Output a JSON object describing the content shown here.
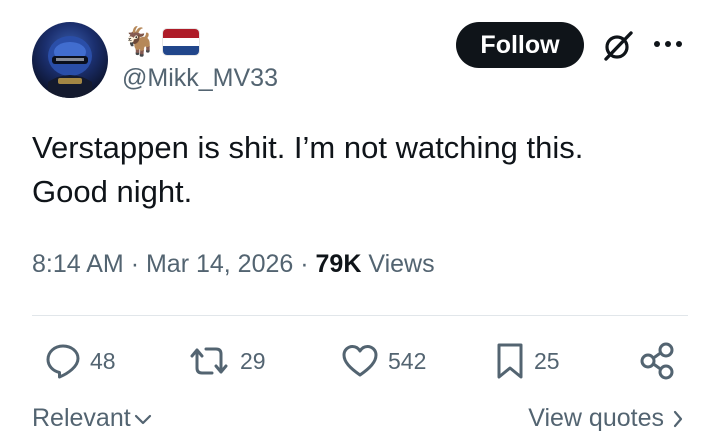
{
  "author": {
    "avatar_icon": "racing-helmet-avatar",
    "name_emoji": "🐐",
    "flag": {
      "icon": "netherlands-flag",
      "colors": [
        "#ae1c28",
        "#ffffff",
        "#21468b"
      ]
    },
    "handle": "@Mikk_MV33"
  },
  "header": {
    "follow_label": "Follow",
    "grok_icon": "grok-icon",
    "more_icon": "more-icon"
  },
  "tweet": {
    "lines": [
      "Verstappen is shit. I’m not watching this.",
      "Good night."
    ],
    "time": "8:14 AM",
    "separator": "·",
    "date": "Mar 14, 2026",
    "views_count": "79K",
    "views_label": "Views"
  },
  "actions": {
    "replies": "48",
    "reposts": "29",
    "likes": "542",
    "bookmarks": "25"
  },
  "footer": {
    "sort_label": "Relevant",
    "view_quotes_label": "View quotes"
  },
  "colors": {
    "text": "#0f1419",
    "secondary": "#536471",
    "follow_bg": "#0f1419",
    "divider": "#e1e6ea"
  }
}
